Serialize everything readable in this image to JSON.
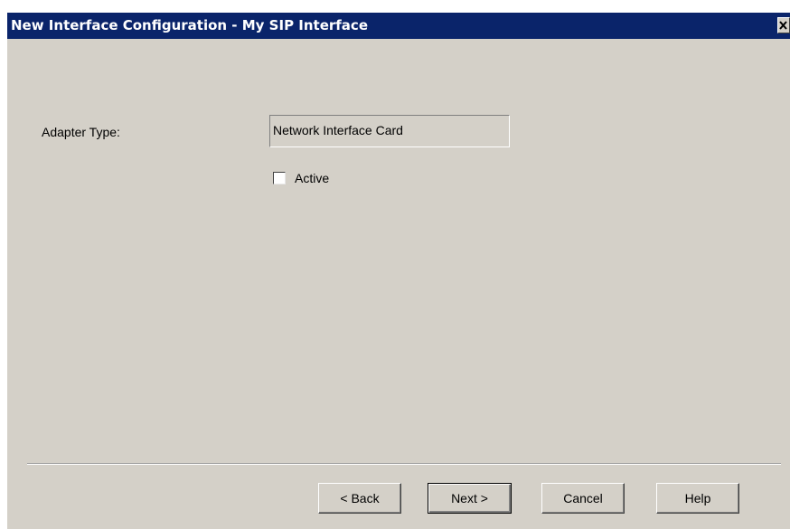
{
  "window": {
    "title": "New Interface Configuration - My SIP Interface",
    "close_glyph": "✕"
  },
  "form": {
    "adapter_type_label": "Adapter Type:",
    "adapter_type_value": "Network Interface Card",
    "active_label": "Active",
    "active_checked": false
  },
  "buttons": {
    "back": "< Back",
    "next": "Next >",
    "cancel": "Cancel",
    "help": "Help"
  },
  "colors": {
    "titlebar": "#0a246a",
    "dialog_face": "#d4d0c8"
  },
  "icons": {
    "close": "close-icon"
  }
}
